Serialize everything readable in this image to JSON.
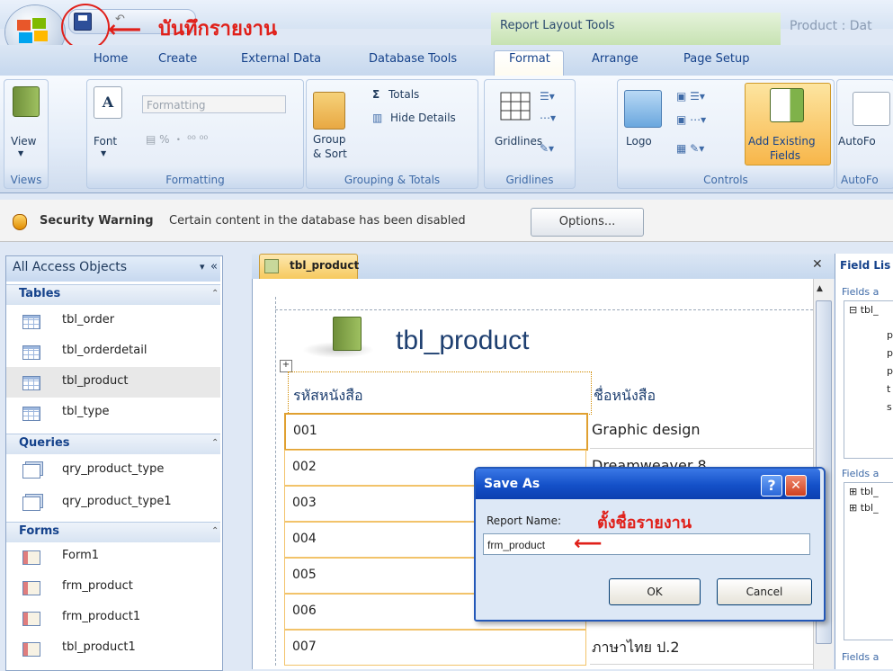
{
  "annotations": {
    "save_report": "บันทึกรายงาน",
    "name_report": "ตั้งชื่อรายงาน"
  },
  "titlebar": {
    "context_tools": "Report Layout Tools",
    "doc_title": "Product : Dat"
  },
  "tabs": [
    "Home",
    "Create",
    "External Data",
    "Database Tools",
    "Format",
    "Arrange",
    "Page Setup"
  ],
  "ribbon": {
    "views": {
      "view_label": "View",
      "group": "Views"
    },
    "font": {
      "font_label": "Font",
      "format_combo": "Formatting",
      "group": "Formatting"
    },
    "grouping": {
      "totals": "Totals",
      "hide_details": "Hide Details",
      "group_sort_1": "Group",
      "group_sort_2": "& Sort",
      "group": "Grouping & Totals"
    },
    "gridlines": {
      "label": "Gridlines",
      "group": "Gridlines"
    },
    "controls": {
      "logo": "Logo",
      "add_existing_1": "Add Existing",
      "add_existing_2": "Fields",
      "group": "Controls"
    },
    "autoformat": {
      "label": "AutoFo",
      "group": "AutoFo"
    }
  },
  "security": {
    "title": "Security Warning",
    "message": "Certain content in the database has been disabled",
    "options": "Options..."
  },
  "nav": {
    "title": "All Access Objects",
    "sections": [
      {
        "label": "Tables",
        "items": [
          "tbl_order",
          "tbl_orderdetail",
          "tbl_product",
          "tbl_type"
        ]
      },
      {
        "label": "Queries",
        "items": [
          "qry_product_type",
          "qry_product_type1"
        ]
      },
      {
        "label": "Forms",
        "items": [
          "Form1",
          "frm_product",
          "frm_product1",
          "tbl_product1"
        ]
      }
    ]
  },
  "document": {
    "tab": "tbl_product",
    "report_title": "tbl_product",
    "columns": [
      "รหัสหนังสือ",
      "ชื่อหนังสือ"
    ],
    "codes": [
      "001",
      "002",
      "003",
      "004",
      "005",
      "006",
      "007"
    ],
    "names": [
      "Graphic design",
      "Dreamweaver 8",
      "",
      "",
      "",
      "",
      "ภาษาไทย ป.2"
    ]
  },
  "field_list": {
    "title": "Field Lis",
    "fields_a1": "Fields a",
    "tbl1": "tbl_",
    "cols": [
      "p",
      "p",
      "p",
      "t",
      "s"
    ],
    "fields_a2": "Fields a",
    "tbl2": "tbl_",
    "tbl3": "tbl_",
    "fields_a3": "Fields a"
  },
  "dialog": {
    "title": "Save As",
    "label": "Report Name:",
    "value": "frm_product",
    "ok": "OK",
    "cancel": "Cancel"
  }
}
